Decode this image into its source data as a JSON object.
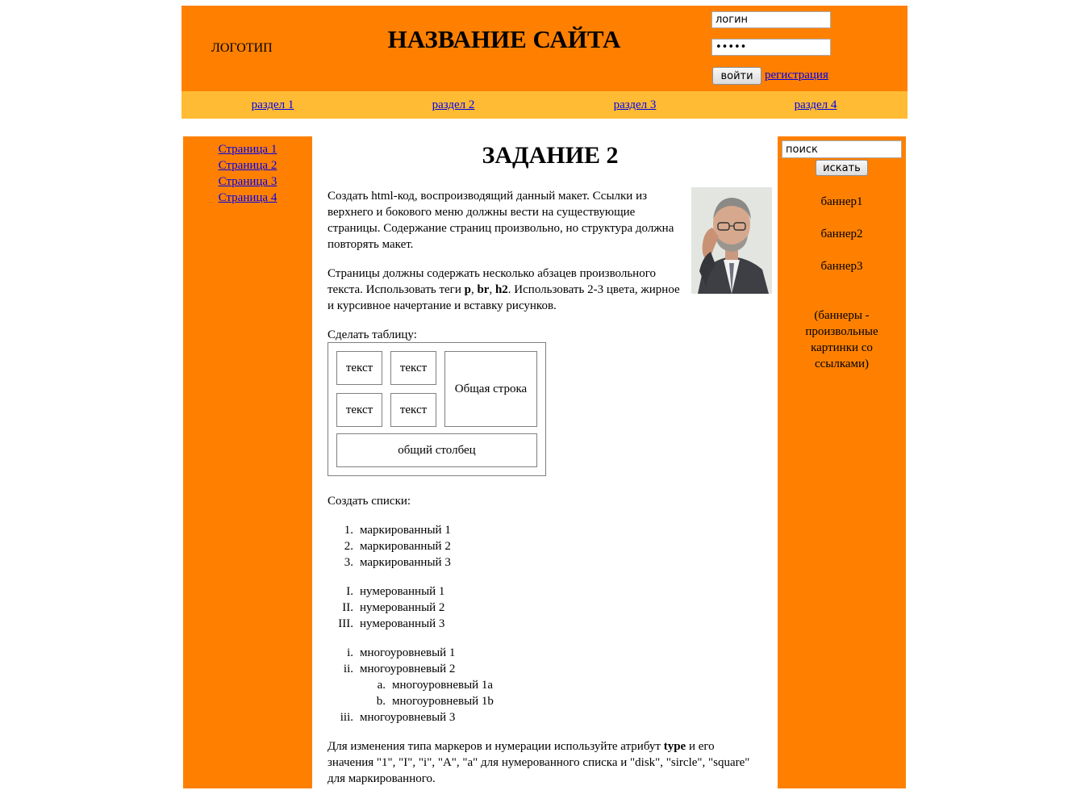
{
  "header": {
    "logo": "ЛОГОТИП",
    "title": "НАЗВАНИЕ САЙТА",
    "login_value": "логин",
    "password_value": "•••••",
    "login_button": "войти",
    "register_link": "регистрация"
  },
  "nav": [
    "раздел 1",
    "раздел 2",
    "раздел 3",
    "раздел 4"
  ],
  "left_menu": [
    "Страница 1",
    "Страница 2",
    "Страница 3",
    "Страница 4"
  ],
  "right": {
    "search_value": "поиск",
    "search_button": "искать",
    "banners": [
      "баннер1",
      "баннер2",
      "баннер3"
    ],
    "note": "(баннеры - произвольные картинки со ссылками)"
  },
  "main": {
    "heading": "ЗАДАНИЕ 2",
    "p1": "Создать html-код, воспроизводящий данный макет. Ссылки из верхнего и бокового меню должны вести на существующие страницы. Содержание страниц произвольно, но структура должна повторять макет.",
    "p2_a": "Страницы должны содержать несколько абзацев произвольного текста. Использовать теги ",
    "p2_tag1": "p",
    "p2_comma1": ", ",
    "p2_tag2": "br",
    "p2_comma2": ", ",
    "p2_tag3": "h2",
    "p2_b": ". Использовать 2-3 цвета, жирное и курсивное начертание и вставку рисунков.",
    "table_intro": "Сделать таблицу:",
    "table": {
      "cell": "текст",
      "merged_row": "Общая строка",
      "merged_col": "общий столбец"
    },
    "lists_intro": "Создать списки:",
    "list1": [
      {
        "mark": "1.",
        "text": "маркированный 1"
      },
      {
        "mark": "2.",
        "text": "маркированный 2"
      },
      {
        "mark": "3.",
        "text": "маркированный 3"
      }
    ],
    "list2": [
      {
        "mark": "I.",
        "text": "нумерованный 1"
      },
      {
        "mark": "II.",
        "text": "нумерованный 2"
      },
      {
        "mark": "III.",
        "text": "нумерованный 3"
      }
    ],
    "list3": [
      {
        "mark": "i.",
        "text": "многоуровневый 1"
      },
      {
        "mark": "ii.",
        "text": "многоуровневый 2"
      },
      {
        "mark": "a.",
        "text": "многоуровневый 1а",
        "sub": true
      },
      {
        "mark": "b.",
        "text": "многоуровневый 1b",
        "sub": true
      },
      {
        "mark": "iii.",
        "text": "многоуровневый 3"
      }
    ],
    "p5_a": "Для изменения типа маркеров и нумерации используйте атрибут ",
    "p5_attr": "type",
    "p5_b": " и его значения \"1\", \"I\", \"i\", \"A\", \"a\" для нумерованного списка и \"disk\", \"sircle\", \"square\" для маркированного."
  },
  "colors": {
    "orange": "#ff8000",
    "nav_yellow": "#ffbb33",
    "link": "#0000ee"
  }
}
